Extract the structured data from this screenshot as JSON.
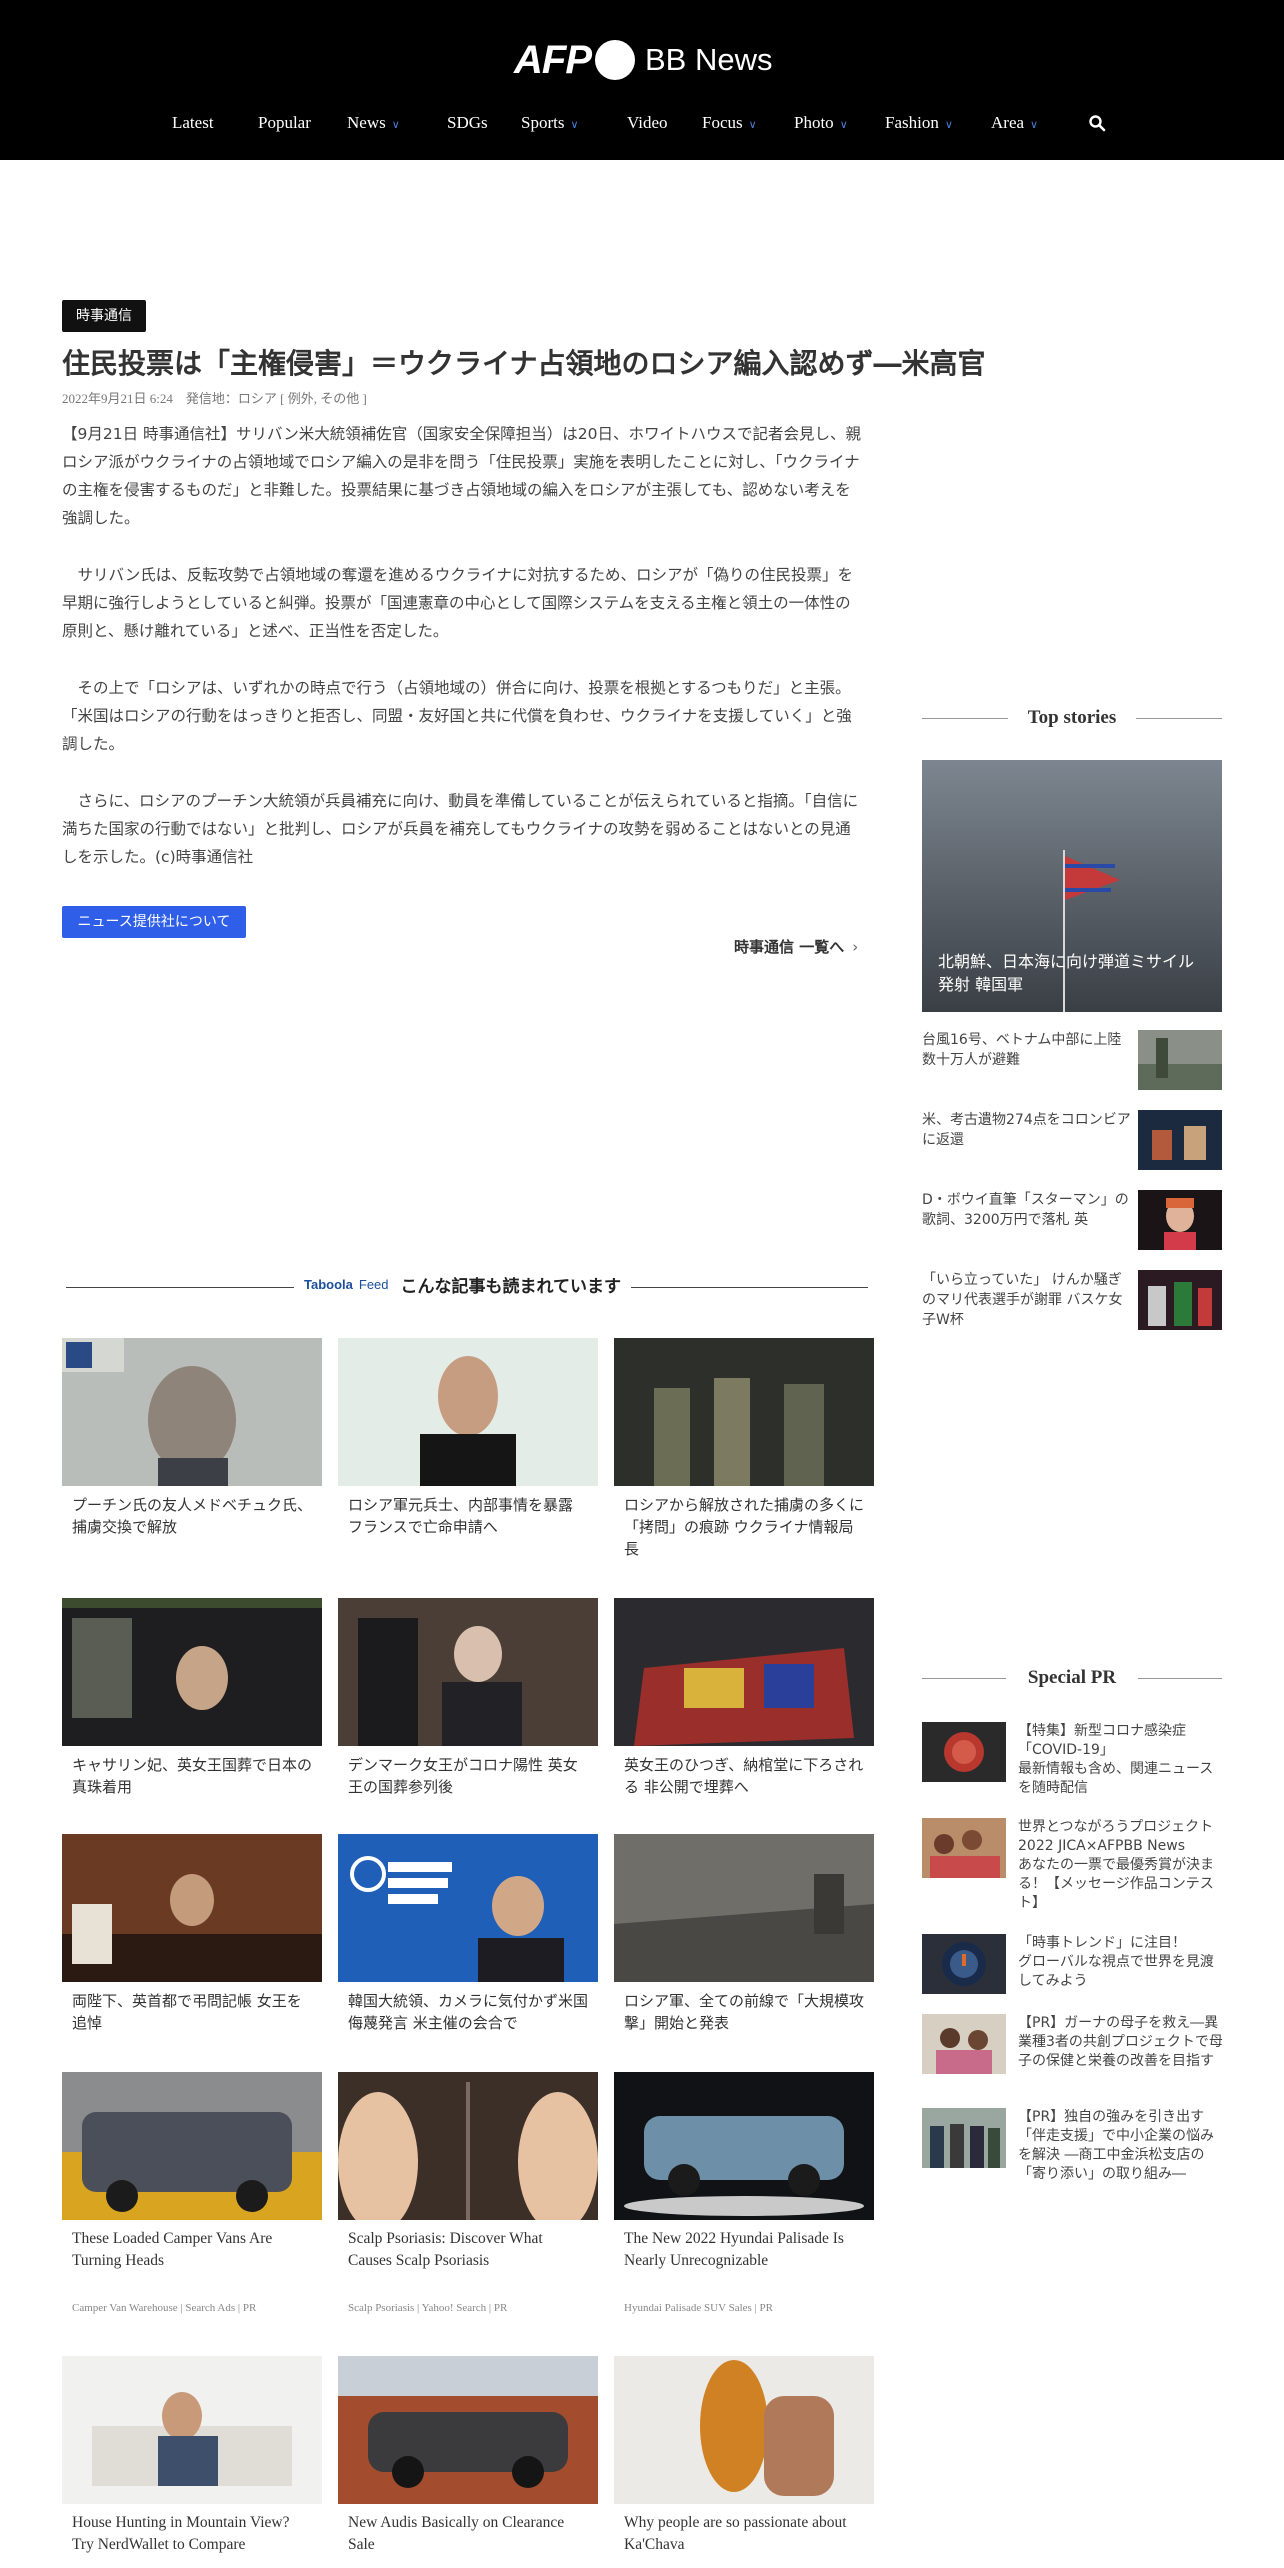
{
  "header": {
    "logo": {
      "afp": "AFP",
      "bb": "BB News"
    },
    "nav": [
      {
        "label": "Latest",
        "dropdown": false
      },
      {
        "label": "Popular",
        "dropdown": false
      },
      {
        "label": "News",
        "dropdown": true
      },
      {
        "label": "SDGs",
        "dropdown": false
      },
      {
        "label": "Sports",
        "dropdown": true
      },
      {
        "label": "Video",
        "dropdown": false
      },
      {
        "label": "Focus",
        "dropdown": true
      },
      {
        "label": "Photo",
        "dropdown": true
      },
      {
        "label": "Fashion",
        "dropdown": true
      },
      {
        "label": "Area",
        "dropdown": true
      }
    ],
    "search_icon": "search-icon"
  },
  "article": {
    "source": "時事通信",
    "title": "住民投票は「主権侵害」＝ウクライナ占領地のロシア編入認めず―米高官",
    "meta": "2022年9月21日 6:24　発信地：ロシア [ 例外, その他 ]",
    "paragraphs": [
      "【9月21日 時事通信社】サリバン米大統領補佐官（国家安全保障担当）は20日、ホワイトハウスで記者会見し、親ロシア派がウクライナの占領地域でロシア編入の是非を問う「住民投票」実施を表明したことに対し、「ウクライナの主権を侵害するものだ」と非難した。投票結果に基づき占領地域の編入をロシアが主張しても、認めない考えを強調した。",
      "　サリバン氏は、反転攻勢で占領地域の奪還を進めるウクライナに対抗するため、ロシアが「偽りの住民投票」を早期に強行しようとしていると糾弾。投票が「国連憲章の中心として国際システムを支える主権と領土の一体性の原則と、懸け離れている」と述べ、正当性を否定した。",
      "　その上で「ロシアは、いずれかの時点で行う（占領地域の）併合に向け、投票を根拠とするつもりだ」と主張。「米国はロシアの行動をはっきりと拒否し、同盟・友好国と共に代償を負わせ、ウクライナを支援していく」と強調した。",
      "　さらに、ロシアのプーチン大統領が兵員補充に向け、動員を準備していることが伝えられていると指摘。「自信に満ちた国家の行動ではない」と批判し、ロシアが兵員を補充してもウクライナの攻勢を弱めることはないとの見通しを示した。(c)時事通信社"
    ],
    "provider_button": "ニュース提供社について",
    "list_link": "時事通信 一覧へ",
    "list_arrow": "›"
  },
  "taboola": {
    "brand": "Taboola",
    "feed": "Feed",
    "title": "こんな記事も読まれています",
    "cards": [
      {
        "caption": "プーチン氏の友人メドベチュク氏、捕虜交換で解放",
        "sponsor": ""
      },
      {
        "caption": "ロシア軍元兵士、内部事情を暴露 フランスで亡命申請へ",
        "sponsor": ""
      },
      {
        "caption": "ロシアから解放された捕虜の多くに「拷問」の痕跡 ウクライナ情報局長",
        "sponsor": ""
      },
      {
        "caption": "キャサリン妃、英女王国葬で日本の真珠着用",
        "sponsor": ""
      },
      {
        "caption": "デンマーク女王がコロナ陽性 英女王の国葬参列後",
        "sponsor": ""
      },
      {
        "caption": "英女王のひつぎ、納棺堂に下ろされる 非公開で埋葬へ",
        "sponsor": ""
      },
      {
        "caption": "両陛下、英首都で弔問記帳 女王を追悼",
        "sponsor": ""
      },
      {
        "caption": "韓国大統領、カメラに気付かず米国侮蔑発言 米主催の会合で",
        "sponsor": ""
      },
      {
        "caption": "ロシア軍、全ての前線で「大規模攻撃」開始と発表",
        "sponsor": ""
      },
      {
        "caption": "These Loaded Camper Vans Are Turning Heads",
        "sponsor": "Camper Van Warehouse | Search Ads | PR"
      },
      {
        "caption": "Scalp Psoriasis: Discover What Causes Scalp Psoriasis",
        "sponsor": "Scalp Psoriasis | Yahoo! Search | PR"
      },
      {
        "caption": "The New 2022 Hyundai Palisade Is Nearly Unrecognizable",
        "sponsor": "Hyundai Palisade SUV Sales | PR"
      },
      {
        "caption": "House Hunting in Mountain View? Try NerdWallet to Compare",
        "sponsor": ""
      },
      {
        "caption": "New Audis Basically on Clearance Sale",
        "sponsor": ""
      },
      {
        "caption": "Why people are so passionate about Ka'Chava",
        "sponsor": ""
      }
    ]
  },
  "sidebar": {
    "top_stories_title": "Top stories",
    "hero_title": "北朝鮮、日本海に向け弾道ミサイル発射 韓国軍",
    "top_stories": [
      {
        "title": "台風16号、ベトナム中部に上陸 数十万人が避難"
      },
      {
        "title": "米、考古遺物274点をコロンビアに返還"
      },
      {
        "title": "D・ボウイ直筆「スターマン」の歌詞、3200万円で落札 英"
      },
      {
        "title": "「いら立っていた」 けんか騒ぎのマリ代表選手が謝罪 バスケ女子W杯"
      }
    ],
    "special_pr_title": "Special PR",
    "special_pr": [
      {
        "title": "【特集】新型コロナ感染症「COVID-19」",
        "sub": "最新情報も含め、関連ニュースを随時配信"
      },
      {
        "title": "世界とつながろうプロジェクト2022 JICA×AFPBB News",
        "sub": "あなたの一票で最優秀賞が決まる！【メッセージ作品コンテスト】"
      },
      {
        "title": "「時事トレンド」に注目！",
        "sub": "グローバルな視点で世界を見渡してみよう"
      },
      {
        "title": "【PR】ガーナの母子を救え―異業種3者の共創プロジェクトで母子の保健と栄養の改善を目指す",
        "sub": ""
      },
      {
        "title": "【PR】独自の強みを引き出す「伴走支援」で中小企業の悩みを解決 ―商工中金浜松支店の「寄り添い」の取り組み―",
        "sub": ""
      }
    ]
  },
  "colors": {
    "header_bg": "#000000",
    "accent_blue": "#2f5fe8",
    "caret_blue": "#4a7bd8",
    "badge_bg": "#111111"
  }
}
